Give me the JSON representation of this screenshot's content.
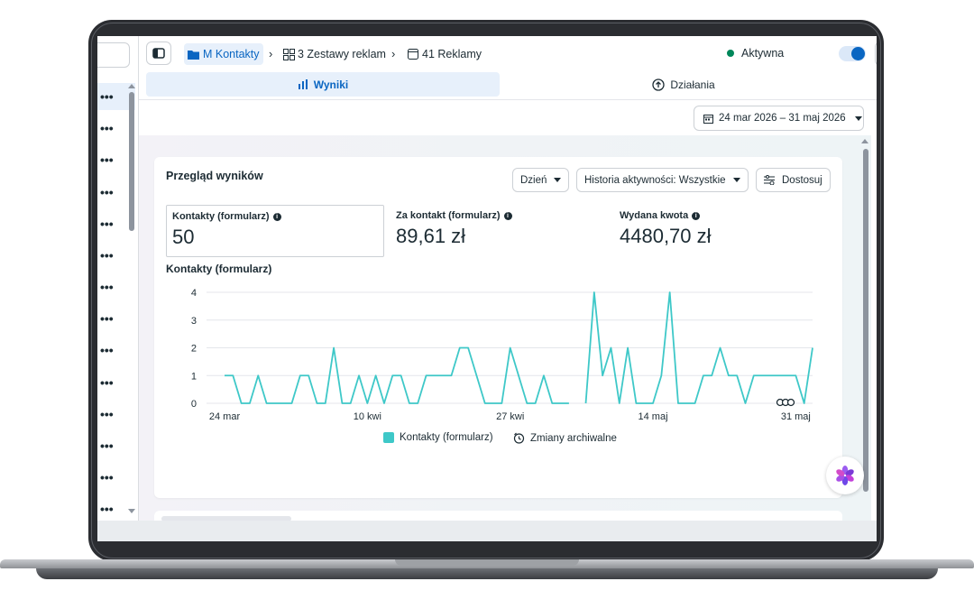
{
  "breadcrumb": {
    "campaign": "M Kontakty",
    "adsets": "3 Zestawy reklam",
    "ads": "41 Reklamy"
  },
  "status": {
    "label": "Aktywna",
    "color": "#00875a"
  },
  "tabs": [
    {
      "label": "Wyniki",
      "selected": true
    },
    {
      "label": "Działania",
      "selected": false
    }
  ],
  "date_range": "24 mar 2026 – 31 maj 2026",
  "overview": {
    "title": "Przegląd wyników",
    "granularity": "Dzień",
    "history_filter": "Historia aktywności: Wszystkie",
    "customize": "Dostosuj",
    "metrics": [
      {
        "label": "Kontakty (formularz)",
        "value": "50",
        "selected": true
      },
      {
        "label": "Za kontakt (formularz)",
        "value": "89,61 zł",
        "selected": false
      },
      {
        "label": "Wydana kwota",
        "value": "4480,70 zł",
        "selected": false
      }
    ]
  },
  "chart_title": "Kontakty (formularz)",
  "legend": {
    "series": "Kontakty (formularz)",
    "archive": "Zmiany archiwalne"
  },
  "icons": [
    "panel-toggle-icon",
    "folder-icon",
    "grid-icon",
    "calendar-icon",
    "chart-icon",
    "upload-icon",
    "settings-icon",
    "clock-icon",
    "ai-assistant-icon"
  ],
  "colors": {
    "accent": "#0a66c2",
    "series": "#3ec8c8"
  },
  "chart_data": {
    "type": "line",
    "title": "Kontakty (formularz)",
    "x_ticks": [
      "24 mar",
      "10 kwi",
      "27 kwi",
      "14 maj",
      "31 maj"
    ],
    "x_tick_index": [
      0,
      17,
      34,
      51,
      68
    ],
    "ylim": [
      0,
      4
    ],
    "y_ticks": [
      0,
      1,
      2,
      3,
      4
    ],
    "grid": true,
    "series": [
      {
        "name": "Kontakty (formularz)",
        "values": [
          1,
          1,
          0,
          0,
          1,
          0,
          0,
          0,
          0,
          1,
          1,
          0,
          0,
          2,
          0,
          0,
          1,
          0,
          1,
          0,
          1,
          1,
          0,
          0,
          1,
          1,
          1,
          1,
          2,
          2,
          1,
          0,
          0,
          0,
          2,
          1,
          0,
          0,
          1,
          0,
          0,
          0,
          null,
          0,
          4,
          1,
          2,
          0,
          2,
          0,
          0,
          0,
          1,
          4,
          0,
          0,
          0,
          1,
          1,
          2,
          1,
          1,
          0,
          1,
          1,
          1,
          1,
          1,
          1,
          0,
          2
        ]
      }
    ]
  }
}
